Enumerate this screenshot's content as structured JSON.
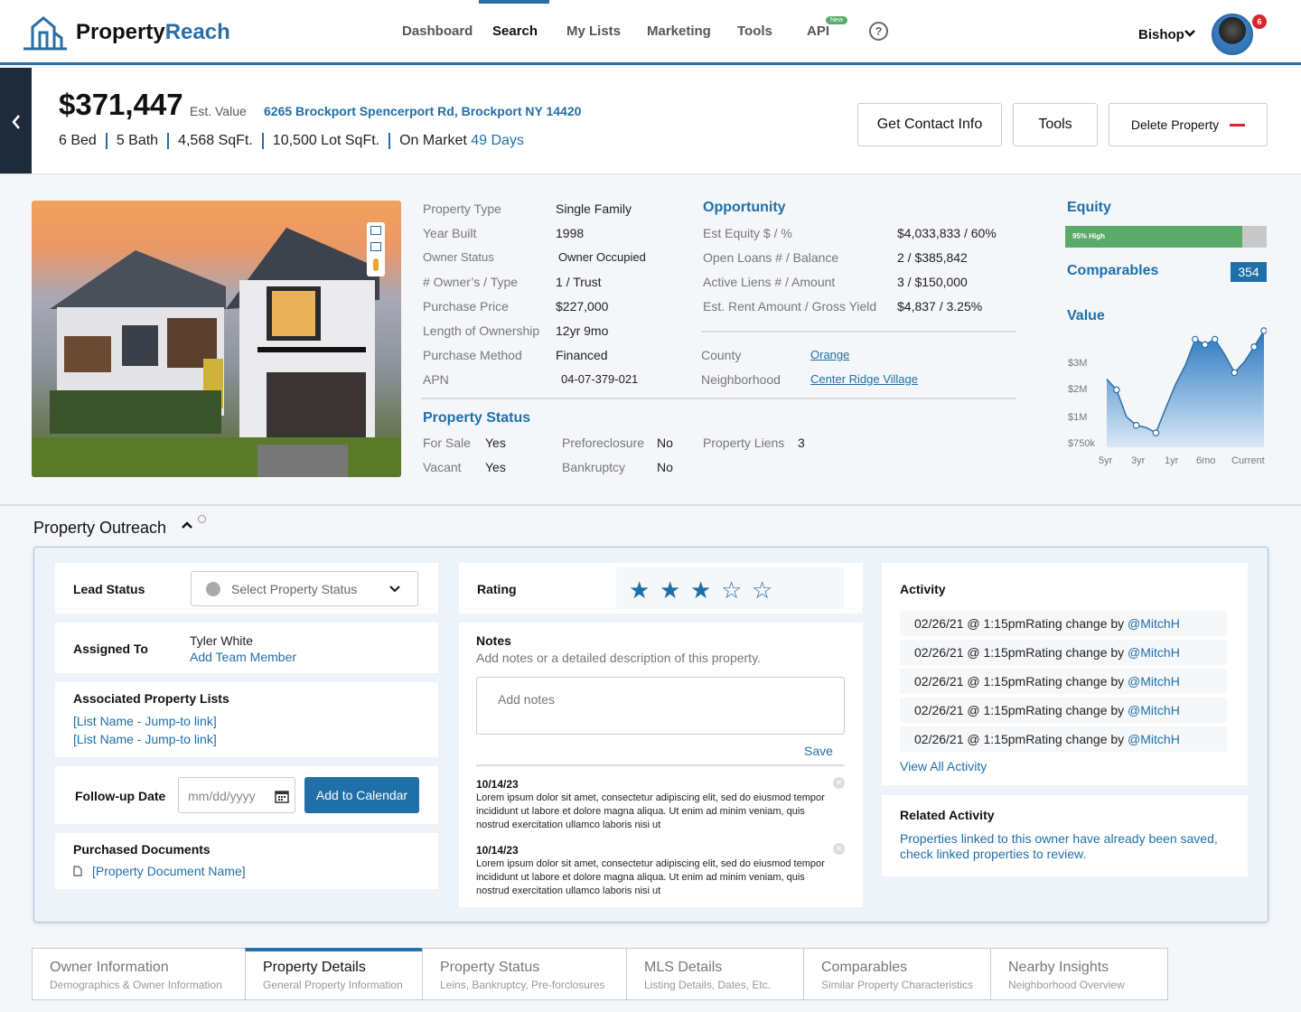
{
  "app": {
    "brand_part1": "Property",
    "brand_part2": "Reach"
  },
  "nav": {
    "items": [
      "Dashboard",
      "Search",
      "My Lists",
      "Marketing",
      "Tools",
      "API"
    ],
    "new_badge": "New",
    "help": "?",
    "user": "Bishop",
    "notif_count": "6"
  },
  "header": {
    "price": "$371,447",
    "est_label": "Est. Value",
    "address": "6265 Brockport Spencerport Rd, Brockport NY 14420",
    "beds": "6 Bed",
    "baths": "5 Bath",
    "sqft": "4,568 SqFt.",
    "lot": "10,500 Lot SqFt.",
    "market_label": "On Market",
    "market_days": "49 Days",
    "btn_contact": "Get Contact Info",
    "btn_tools": "Tools",
    "btn_delete": "Delete Property"
  },
  "details": {
    "rows": [
      {
        "label": "Property Type",
        "value": "Single Family"
      },
      {
        "label": "Year Built",
        "value": "1998"
      },
      {
        "label": "Owner Status",
        "value": "Owner Occupied"
      },
      {
        "label": "# Owner’s / Type",
        "value": "1 / Trust"
      },
      {
        "label": "Purchase Price",
        "value": "$227,000"
      },
      {
        "label": "Length of Ownership",
        "value": "12yr 9mo"
      },
      {
        "label": "Purchase Method",
        "value": "Financed"
      },
      {
        "label": "APN",
        "value": "04-07-379-021"
      }
    ]
  },
  "opportunity": {
    "title": "Opportunity",
    "rows": [
      {
        "label": "Est Equity $ / %",
        "value": "$4,033,833 / 60%"
      },
      {
        "label": "Open Loans # / Balance",
        "value": "2 / $385,842"
      },
      {
        "label": "Active Liens # / Amount",
        "value": "3 / $150,000"
      },
      {
        "label": "Est. Rent Amount / Gross Yield",
        "value": "$4,837 / 3.25%"
      }
    ],
    "county_label": "County",
    "county": "Orange",
    "neighborhood_label": "Neighborhood",
    "neighborhood": "Center Ridge Village"
  },
  "status": {
    "title": "Property Status",
    "for_sale_label": "For Sale",
    "for_sale": "Yes",
    "vacant_label": "Vacant",
    "vacant": "Yes",
    "preforeclosure_label": "Preforeclosure",
    "preforeclosure": "No",
    "bankruptcy_label": "Bankruptcy",
    "bankruptcy": "No",
    "liens_label": "Property Liens",
    "liens": "3"
  },
  "sidebar": {
    "equity_title": "Equity",
    "equity_text": "95% High",
    "equity_pct": 0.88,
    "comparables_title": "Comparables",
    "comparables_count": "354",
    "value_title": "Value"
  },
  "chart_data": {
    "type": "area",
    "title": "Value",
    "x_ticks": [
      "5yr",
      "3yr",
      "1yr",
      "6mo",
      "Current"
    ],
    "y_ticks": [
      "$3M",
      "$2M",
      "$1M",
      "$750k"
    ],
    "series": [
      {
        "values": [
          0.55,
          0.45,
          0.2,
          0.12,
          0.1,
          0.05,
          0.28,
          0.5,
          0.68,
          0.92,
          0.87,
          0.92,
          0.78,
          0.61,
          0.71,
          0.85,
          1.0
        ]
      }
    ]
  },
  "outreach": {
    "title": "Property Outreach",
    "lead_status_label": "Lead Status",
    "lead_status_placeholder": "Select Property Status",
    "assigned_label": "Assigned To",
    "assigned_name": "Tyler White",
    "add_member": "Add Team Member",
    "lists_label": "Associated Property Lists",
    "list_links": [
      "[List Name - Jump-to link]",
      "[List Name - Jump-to link]"
    ],
    "followup_label": "Follow-up Date",
    "date_placeholder": "mm/dd/yyyy",
    "add_calendar": "Add to Calendar",
    "docs_label": "Purchased Documents",
    "doc_name": "[Property Document Name]",
    "rating_label": "Rating",
    "rating_value": 3,
    "rating_max": 5,
    "notes_label": "Notes",
    "notes_hint": "Add notes or a detailed description of this property.",
    "notes_placeholder": "Add notes",
    "save": "Save",
    "notes": [
      {
        "date": "10/14/23",
        "text": "Lorem ipsum dolor sit amet, consectetur adipiscing elit, sed do eiusmod tempor incididunt ut labore et dolore magna aliqua. Ut enim ad minim veniam, quis nostrud exercitation ullamco laboris nisi ut"
      },
      {
        "date": "10/14/23",
        "text": "Lorem ipsum dolor sit amet, consectetur adipiscing elit, sed do eiusmod tempor incididunt ut labore et dolore magna aliqua. Ut enim ad minim veniam, quis nostrud exercitation ullamco laboris nisi ut"
      }
    ],
    "activity_label": "Activity",
    "activity": [
      {
        "time": "02/26/21 @ 1:15pm",
        "text": "Rating change by",
        "user": "@MitchH"
      },
      {
        "time": "02/26/21 @ 1:15pm",
        "text": "Rating change by",
        "user": "@MitchH"
      },
      {
        "time": "02/26/21 @ 1:15pm",
        "text": "Rating change by",
        "user": "@MitchH"
      },
      {
        "time": "02/26/21 @ 1:15pm",
        "text": "Rating change by",
        "user": "@MitchH"
      },
      {
        "time": "02/26/21 @ 1:15pm",
        "text": "Rating change by",
        "user": "@MitchH"
      }
    ],
    "view_all": "View All Activity",
    "related_label": "Related Activity",
    "related_text": "Properties linked to this owner have already been saved, check linked properties to review."
  },
  "tabs": [
    {
      "title": "Owner Information",
      "sub": "Demographics & Owner Information"
    },
    {
      "title": "Property Details",
      "sub": "General Property Information"
    },
    {
      "title": "Property Status",
      "sub": "Leins, Bankruptcy, Pre-forclosures"
    },
    {
      "title": "MLS Details",
      "sub": "Listing Details, Dates, Etc."
    },
    {
      "title": "Comparables",
      "sub": "Similar Property Characteristics"
    },
    {
      "title": "Nearby Insights",
      "sub": "Neighborhood Overview"
    }
  ],
  "colors": {
    "accent": "#2a6ea6",
    "link": "#1f6fa8",
    "equity": "#5aaa6a",
    "danger": "#d9262c"
  }
}
